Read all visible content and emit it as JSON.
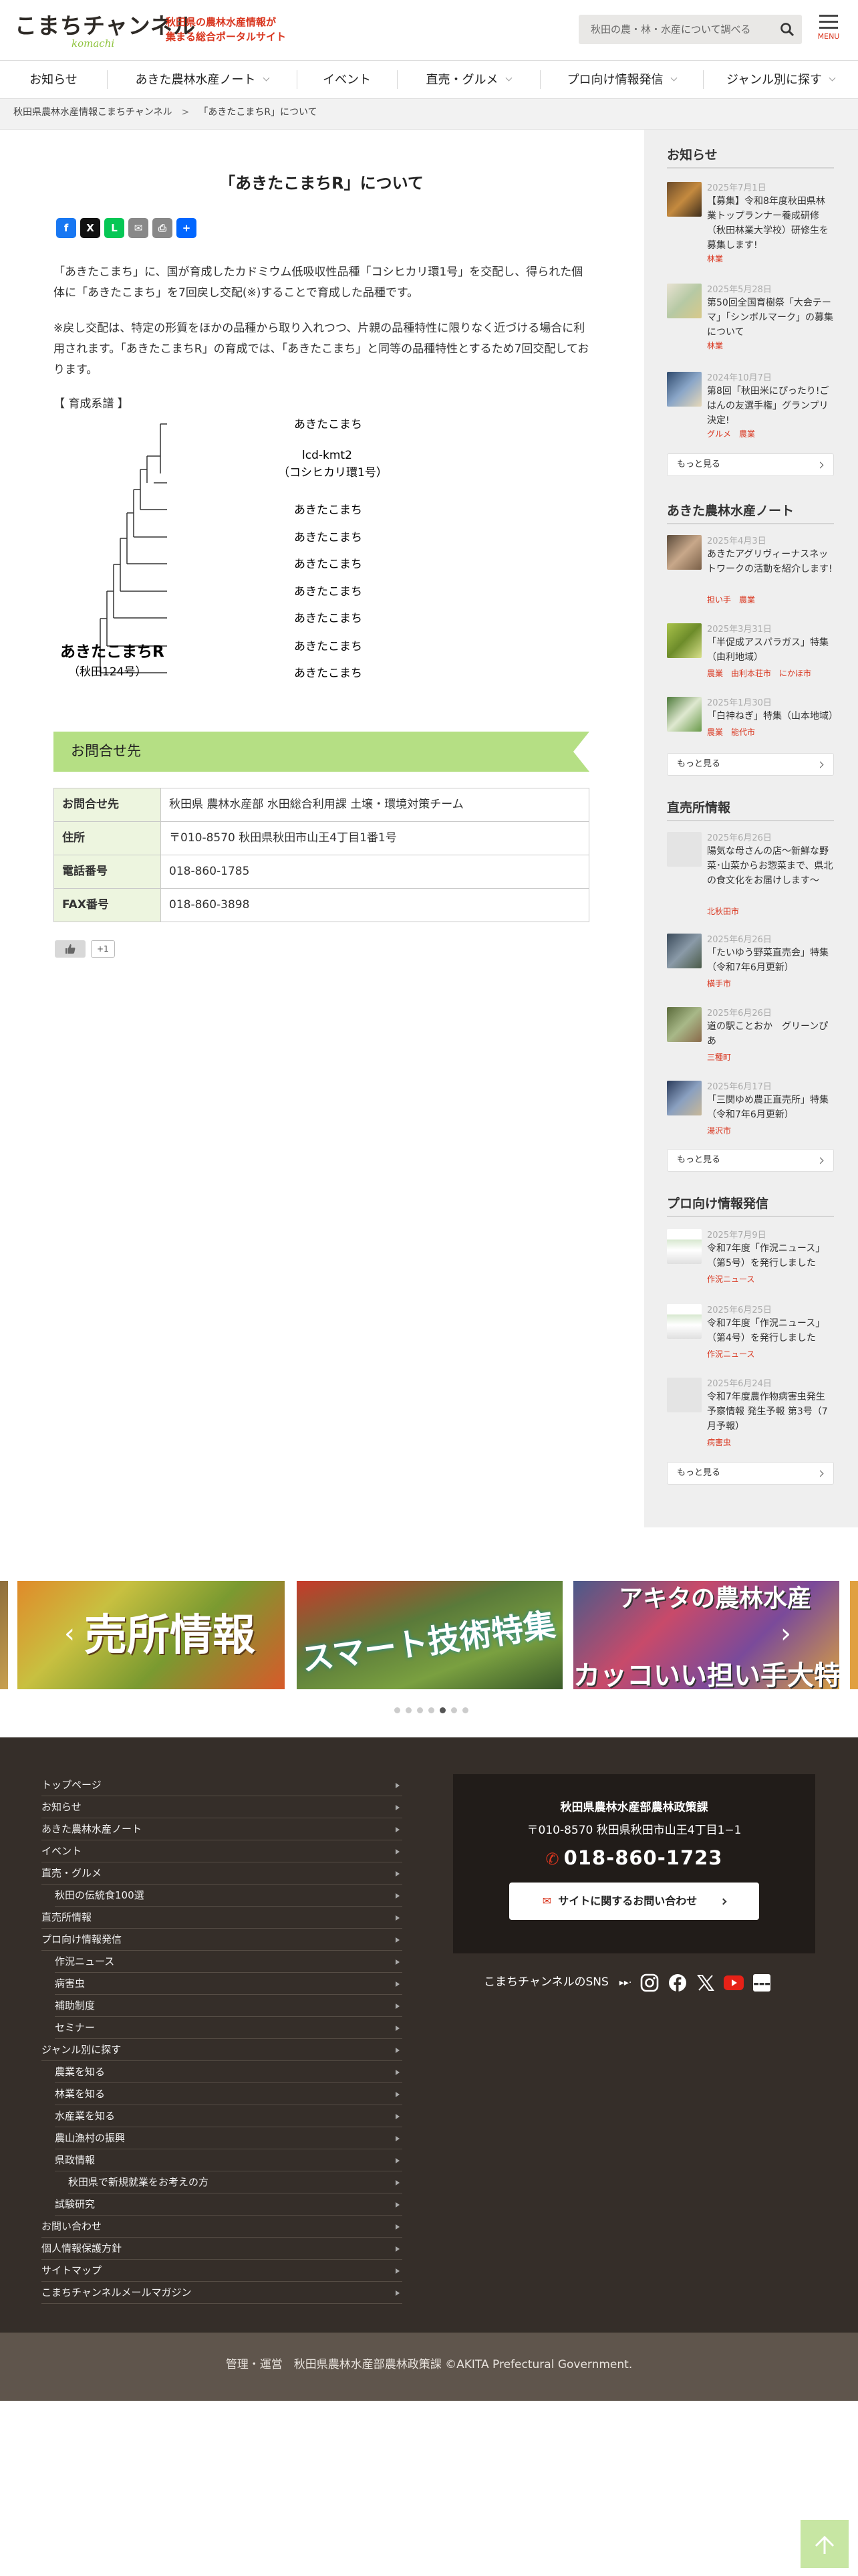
{
  "header": {
    "logo": "こまちチャンネル",
    "logo_script": "komachi",
    "tagline_1": "秋田県の農林水産情報が",
    "tagline_2": "集まる総合ポータルサイト",
    "search_placeholder": "秋田の農・林・水産について調べる",
    "menu_label": "MENU"
  },
  "nav": {
    "items": [
      "お知らせ",
      "あきた農林水産ノート",
      "イベント",
      "直売・グルメ",
      "プロ向け情報発信",
      "ジャンル別に探す"
    ]
  },
  "breadcrumb": {
    "home": "秋田県農林水産情報こまちチャンネル",
    "current": "「あきたこまちR」について"
  },
  "article": {
    "title": "「あきたこまちR」について",
    "share": [
      "f",
      "X",
      "L",
      "✉",
      "⎙",
      "+"
    ],
    "para1": "「あきたこまち」に、国が育成したカドミウム低吸収性品種「コシヒカリ環1号」を交配し、得られた個体に「あきたこまち」を7回戻し交配(※)することで育成した品種です。",
    "para2": "※戻し交配は、特定の形質をほかの品種から取り入れつつ、片親の品種特性に限りなく近づける場合に利用されます。「あきたこまちR」の育成では、「あきたこまち」と同等の品種特性とするため7回交配しております。",
    "lineage_title": "【 育成系譜 】",
    "lineage": {
      "root": "あきたこまちR",
      "root_sub": "（秋田124号）",
      "top": "あきたこまち",
      "gene": "lcd-kmt2",
      "gene_sub": "（コシヒカリ環1号）",
      "leaves": [
        "あきたこまち",
        "あきたこまち",
        "あきたこまち",
        "あきたこまち",
        "あきたこまち",
        "あきたこまち",
        "あきたこまち"
      ]
    },
    "inquiry_title": "お問合せ先",
    "contact": [
      {
        "label": "お問合せ先",
        "value": "秋田県 農林水産部 水田総合利用課 土壌・環境対策チーム"
      },
      {
        "label": "住所",
        "value": "〒010-8570 秋田県秋田市山王4丁目1番1号"
      },
      {
        "label": "電話番号",
        "value": "018-860-1785"
      },
      {
        "label": "FAX番号",
        "value": "018-860-3898"
      }
    ],
    "like_count": "+1"
  },
  "sidebar": {
    "notice": {
      "title": "お知らせ",
      "items": [
        {
          "date": "2025年7月1日",
          "title": "【募集】令和8年度秋田県林業トップランナー養成研修（秋田林業大学校）研修生を募集します!",
          "tags": [
            "林業"
          ]
        },
        {
          "date": "2025年5月28日",
          "title": "第50回全国育樹祭「大会テーマ」「シンボルマーク」の募集について",
          "tags": [
            "林業"
          ]
        },
        {
          "date": "2024年10月7日",
          "title": "第8回「秋田米にぴったり!ごはんの友選手権」グランプリ決定!",
          "tags": [
            "グルメ",
            "農業"
          ]
        }
      ],
      "more": "もっと見る"
    },
    "note": {
      "title": "あきた農林水産ノート",
      "items": [
        {
          "date": "2025年4月3日",
          "title": "あきたアグリヴィーナスネットワークの活動を紹介します!",
          "tags": [
            "担い手",
            "農業"
          ]
        },
        {
          "date": "2025年3月31日",
          "title": "「半促成アスパラガス」特集（由利地域）",
          "tags": [
            "農業",
            "由利本荘市",
            "にかほ市"
          ]
        },
        {
          "date": "2025年1月30日",
          "title": "「白神ねぎ」特集（山本地域）",
          "tags": [
            "農業",
            "能代市"
          ]
        }
      ],
      "more": "もっと見る"
    },
    "direct": {
      "title": "直売所情報",
      "items": [
        {
          "date": "2025年6月26日",
          "title": "陽気な母さんの店～新鮮な野菜･山菜からお惣菜まで、県北の食文化をお届けします～",
          "tags": [
            "北秋田市"
          ]
        },
        {
          "date": "2025年6月26日",
          "title": "「たいゆう野菜直売会」特集（令和7年6月更新）",
          "tags": [
            "横手市"
          ]
        },
        {
          "date": "2025年6月26日",
          "title": "道の駅ことおか　グリーンぴあ",
          "tags": [
            "三種町"
          ]
        },
        {
          "date": "2025年6月17日",
          "title": "「三関ゆめ農正直売所」特集（令和7年6月更新）",
          "tags": [
            "湯沢市"
          ]
        }
      ],
      "more": "もっと見る"
    },
    "pro": {
      "title": "プロ向け情報発信",
      "items": [
        {
          "date": "2025年7月9日",
          "title": "令和7年度「作況ニュース」（第5号）を発行しました",
          "tags": [
            "作況ニュース"
          ]
        },
        {
          "date": "2025年6月25日",
          "title": "令和7年度「作況ニュース」（第4号）を発行しました",
          "tags": [
            "作況ニュース"
          ]
        },
        {
          "date": "2025年6月24日",
          "title": "令和7年度農作物病害虫発生予察情報 発生予報 第3号（7月予報）",
          "tags": [
            "病害虫"
          ]
        }
      ],
      "more": "もっと見る"
    }
  },
  "banners": [
    {
      "text": "売所情報"
    },
    {
      "text": "スマート技術特集"
    },
    {
      "text": "アキタの農林水産"
    },
    {
      "text": "カッコいい担い手大特集!"
    }
  ],
  "footer": {
    "links": [
      "トップページ",
      "お知らせ",
      "あきた農林水産ノート",
      "イベント",
      "直売・グルメ",
      "秋田の伝統食100選",
      "直売所情報",
      "プロ向け情報発信",
      "作況ニュース",
      "病害虫",
      "補助制度",
      "セミナー",
      "ジャンル別に探す",
      "農業を知る",
      "林業を知る",
      "水産業を知る",
      "農山漁村の振興",
      "県政情報",
      "秋田県で新規就業をお考えの方",
      "試験研究",
      "お問い合わせ",
      "個人情報保護方針",
      "サイトマップ",
      "こまちチャンネルメールマガジン"
    ],
    "org": "秋田県農林水産部農林政策課",
    "address": "〒010-8570 秋田県秋田市山王4丁目1−1",
    "tel": "018-860-1723",
    "contact_button": "サイトに関するお問い合わせ",
    "sns_label": "こまちチャンネルのSNS",
    "copyright": "管理・運営　秋田県農林水産部農林政策課 ©AKITA Prefectural Government."
  },
  "colors": {
    "accent": "#d9361f",
    "green": "#b5df84",
    "footer_bg": "#352e29"
  }
}
